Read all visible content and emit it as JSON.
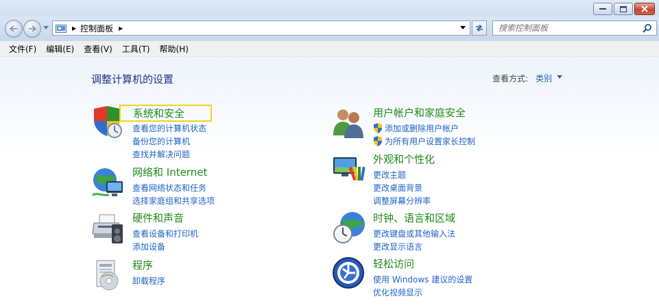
{
  "window": {
    "minimize_glyph": "—",
    "maximize_glyph": "□",
    "close_glyph": "✕"
  },
  "address": {
    "location": "控制面板",
    "search_placeholder": "搜索控制面板"
  },
  "menu": [
    "文件(F)",
    "编辑(E)",
    "查看(V)",
    "工具(T)",
    "帮助(H)"
  ],
  "page": {
    "title": "调整计算机的设置",
    "view_by_label": "查看方式:",
    "view_by_value": "类别"
  },
  "categories": [
    {
      "title": "系统和安全",
      "icon": "shield-check-icon",
      "highlighted": true,
      "links": [
        "查看您的计算机状态",
        "备份您的计算机",
        "查找并解决问题"
      ]
    },
    {
      "title": "网络和 Internet",
      "icon": "network-globe-icon",
      "links": [
        "查看网络状态和任务",
        "选择家庭组和共享选项"
      ]
    },
    {
      "title": "硬件和声音",
      "icon": "printer-speaker-icon",
      "links": [
        "查看设备和打印机",
        "添加设备"
      ]
    },
    {
      "title": "程序",
      "icon": "programs-disc-icon",
      "links": [
        "卸载程序"
      ]
    },
    {
      "title": "用户帐户和家庭安全",
      "icon": "users-icon",
      "links": [
        "添加或删除用户帐户",
        "为所有用户设置家长控制"
      ]
    },
    {
      "title": "外观和个性化",
      "icon": "monitor-palette-icon",
      "links": [
        "更改主题",
        "更改桌面背景",
        "调整屏幕分辨率"
      ]
    },
    {
      "title": "时钟、语言和区域",
      "icon": "clock-globe-icon",
      "links": [
        "更改键盘或其他输入法",
        "更改显示语言"
      ]
    },
    {
      "title": "轻松访问",
      "icon": "ease-of-access-icon",
      "links": [
        "使用 Windows 建议的设置",
        "优化视频显示"
      ]
    }
  ],
  "colors": {
    "category_title": "#1e8a16",
    "link": "#1c64c4",
    "page_title": "#1e3287",
    "highlight_border": "#f2d31b"
  }
}
